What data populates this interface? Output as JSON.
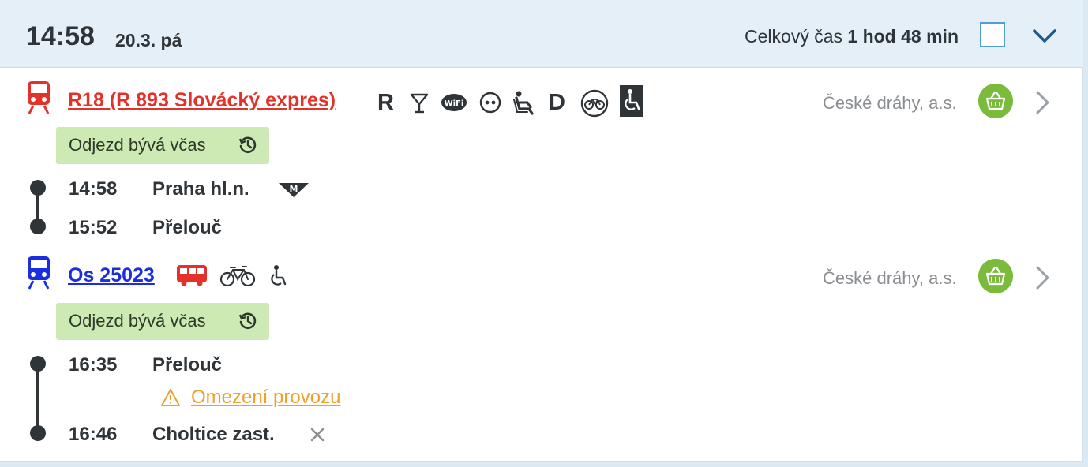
{
  "header": {
    "time": "14:58",
    "date": "20.3. pá",
    "total_label": "Celkový čas",
    "total_value": "1 hod 48 min"
  },
  "legs": [
    {
      "train": "R18 (R 893 Slovácký expres)",
      "carrier": "České dráhy, a.s.",
      "badge": "Odjezd bývá včas",
      "icons": [
        "train-icon",
        "reservation-icon",
        "bar-icon",
        "wifi-icon",
        "power-socket-icon",
        "seat-icon",
        "dining-icon",
        "bicycle-icon",
        "wheelchair-icon"
      ],
      "letters": {
        "reservation": "R",
        "dining": "D"
      },
      "stops": [
        {
          "time": "14:58",
          "name": "Praha hl.n.",
          "icon": "metro-icon"
        },
        {
          "time": "15:52",
          "name": "Přelouč"
        }
      ],
      "color": "#e4322b"
    },
    {
      "train": "Os 25023",
      "carrier": "České dráhy, a.s.",
      "badge": "Odjezd bývá včas",
      "icons": [
        "train-icon",
        "bus-icon",
        "bicycle-icon",
        "wheelchair-icon"
      ],
      "stops": [
        {
          "time": "16:35",
          "name": "Přelouč",
          "notice": "Omezení provozu"
        },
        {
          "time": "16:46",
          "name": "Choltice zast.",
          "icon": "request-stop-icon"
        }
      ],
      "color": "#1a2ee0"
    }
  ],
  "colors": {
    "header_bg": "#e4eff8",
    "badge_bg": "#cdeab4",
    "basket": "#7bbb3b",
    "warning": "#efa02c",
    "checkbox_border": "#4d9fd6"
  }
}
